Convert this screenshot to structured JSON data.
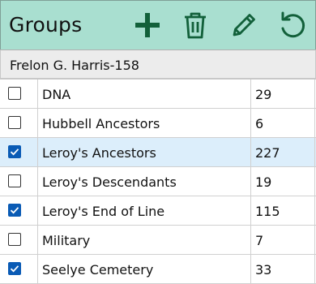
{
  "header": {
    "title": "Groups",
    "icons": [
      "add-icon",
      "trash-icon",
      "pencil-icon",
      "undo-icon"
    ],
    "icon_color": "#12603a",
    "background": "#a9dfd0"
  },
  "person": {
    "name": "Frelon G. Harris-158"
  },
  "groups": [
    {
      "name": "DNA",
      "count": "29",
      "checked": false,
      "selected": false
    },
    {
      "name": "Hubbell Ancestors",
      "count": "6",
      "checked": false,
      "selected": false
    },
    {
      "name": "Leroy's Ancestors",
      "count": "227",
      "checked": true,
      "selected": true
    },
    {
      "name": "Leroy's Descendants",
      "count": "19",
      "checked": false,
      "selected": false
    },
    {
      "name": "Leroy's End of Line",
      "count": "115",
      "checked": true,
      "selected": false
    },
    {
      "name": "Military",
      "count": "7",
      "checked": false,
      "selected": false
    },
    {
      "name": "Seelye Cemetery",
      "count": "33",
      "checked": true,
      "selected": false
    }
  ]
}
